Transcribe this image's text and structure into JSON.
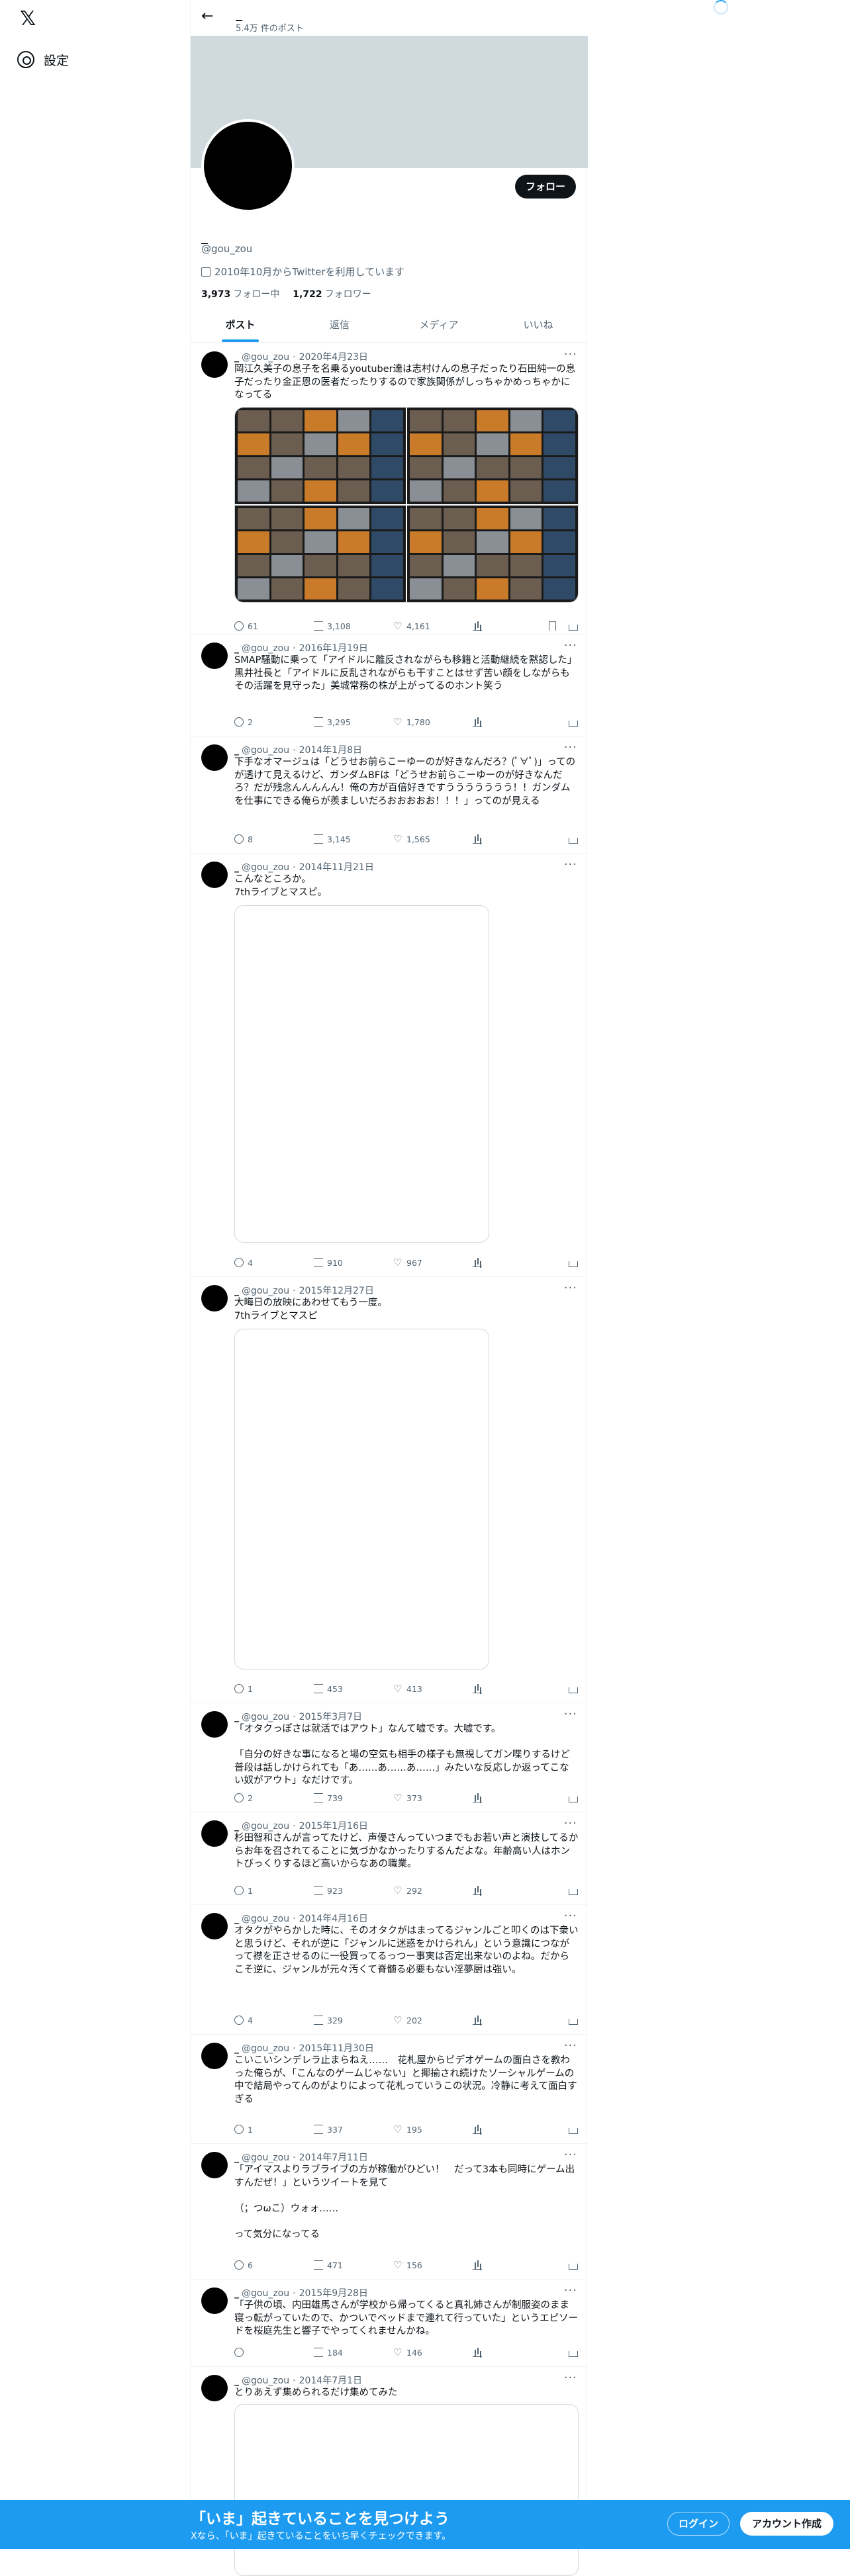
{
  "nav": {
    "logo": "𝕏",
    "settings_label": "設定"
  },
  "header": {
    "name": "_",
    "post_count": "5.4万 件のポスト",
    "back_icon": "←"
  },
  "profile": {
    "name": "_",
    "handle": "@gou_zou",
    "joined": "2010年10月からTwitterを利用しています",
    "following_count": "3,973",
    "following_label": "フォロー中",
    "followers_count": "1,722",
    "followers_label": "フォロワー",
    "follow_button": "フォロー"
  },
  "tabs": [
    "ポスト",
    "返信",
    "メディア",
    "いいね"
  ],
  "tweets": [
    {
      "name": "_",
      "handle": "@gou_zou",
      "sep": "·",
      "date": "2020年4月23日",
      "text": "岡江久美子の息子を名乗るyoutuber達は志村けんの息子だったり石田純一の息子だったり金正恩の医者だったりするので家族関係がしっちゃかめっちゃかになってる",
      "replies": "61",
      "retweets": "3,108",
      "likes": "4,161"
    },
    {
      "name": "_",
      "handle": "@gou_zou",
      "sep": "·",
      "date": "2016年1月19日",
      "text": "SMAP騒動に乗って「アイドルに離反されながらも移籍と活動継続を黙認した」黒井社長と「アイドルに反乱されながらも干すことはせず苦い顔をしながらもその活躍を見守った」美城常務の株が上がってるのホント笑う",
      "replies": "2",
      "retweets": "3,295",
      "likes": "1,780"
    },
    {
      "name": "_",
      "handle": "@gou_zou",
      "sep": "·",
      "date": "2014年1月8日",
      "text": "下手なオマージュは「どうせお前らこーゆーのが好きなんだろ？(ﾟ∀ﾟ)」ってのが透けて見えるけど、ガンダムBFは「どうせお前らこーゆーのが好きなんだろ？だが残念んんんんん！俺の方が百倍好きですううううううう！！ガンダムを仕事にできる俺らが羨ましいだろおおおおお！！！」ってのが見える",
      "replies": "8",
      "retweets": "3,145",
      "likes": "1,565"
    },
    {
      "name": "_",
      "handle": "@gou_zou",
      "sep": "·",
      "date": "2014年11月21日",
      "text": "こんなところか。\n7thライブとマスピ。",
      "replies": "4",
      "retweets": "910",
      "likes": "967"
    },
    {
      "name": "_",
      "handle": "@gou_zou",
      "sep": "·",
      "date": "2015年12月27日",
      "text": "大晦日の放映にあわせてもう一度。\n7thライブとマスピ",
      "replies": "1",
      "retweets": "453",
      "likes": "413"
    },
    {
      "name": "_",
      "handle": "@gou_zou",
      "sep": "·",
      "date": "2015年3月7日",
      "text": "「オタクっぽさは就活ではアウト」なんて嘘です。大嘘です。\n\n「自分の好きな事になると場の空気も相手の様子も無視してガン喋りするけど普段は話しかけられても「あ……あ……あ……」みたいな反応しか返ってこない奴がアウト」なだけです。",
      "replies": "2",
      "retweets": "739",
      "likes": "373"
    },
    {
      "name": "_",
      "handle": "@gou_zou",
      "sep": "·",
      "date": "2015年1月16日",
      "text": "杉田智和さんが言ってたけど、声優さんっていつまでもお若い声と演技してるからお年を召されてることに気づかなかったりするんだよな。年齢高い人はホントびっくりするほど高いからなあの職業。",
      "replies": "1",
      "retweets": "923",
      "likes": "292"
    },
    {
      "name": "_",
      "handle": "@gou_zou",
      "sep": "·",
      "date": "2014年4月16日",
      "text": "オタクがやらかした時に、そのオタクがはまってるジャンルごと叩くのは下衆いと思うけど、それが逆に「ジャンルに迷惑をかけられん」という意識につながって襟を正させるのに一役買ってるっつー事実は否定出来ないのよね。だからこそ逆に、ジャンルが元々汚くて脊髄る必要もない淫夢厨は強い。",
      "replies": "4",
      "retweets": "329",
      "likes": "202"
    },
    {
      "name": "_",
      "handle": "@gou_zou",
      "sep": "·",
      "date": "2015年11月30日",
      "text": "こいこいシンデレラ止まらねえ……　花札屋からビデオゲームの面白さを教わった俺らが、「こんなのゲームじゃない」と揶揄され続けたソーシャルゲームの中で結局やってんのがよりによって花札っていうこの状況。冷静に考えて面白すぎる",
      "replies": "1",
      "retweets": "337",
      "likes": "195"
    },
    {
      "name": "_",
      "handle": "@gou_zou",
      "sep": "·",
      "date": "2014年7月11日",
      "text": "「アイマスよりラブライブの方が稼働がひどい！　だって3本も同時にゲーム出すんだぜ！」というツイートを見て\n\n（；つωこ）ウォォ……\n\nって気分になってる",
      "replies": "6",
      "retweets": "471",
      "likes": "156"
    },
    {
      "name": "_",
      "handle": "@gou_zou",
      "sep": "·",
      "date": "2015年9月28日",
      "text": "「子供の頃、内田雄馬さんが学校から帰ってくると真礼姉さんが制服姿のまま寝っ転がっていたので、かついでベッドまで連れて行っていた」というエピソードを桜庭先生と響子でやってくれませんかね。",
      "replies": "",
      "retweets": "184",
      "likes": "146"
    },
    {
      "name": "_",
      "handle": "@gou_zou",
      "sep": "·",
      "date": "2014年7月1日",
      "text": "とりあえず集められるだけ集めてみた",
      "replies": "",
      "retweets": "",
      "likes": ""
    }
  ],
  "more_icon": "···",
  "bottom_bar": {
    "title": "「いま」起きていることを見つけよう",
    "subtitle": "Xなら、「いま」起きていることをいち早くチェックできます。",
    "login": "ログイン",
    "signup": "アカウント作成"
  },
  "colors": {
    "accent": "#1d9bf0",
    "banner": "#cfd9de",
    "text": "#0f1419",
    "muted": "#536471"
  }
}
